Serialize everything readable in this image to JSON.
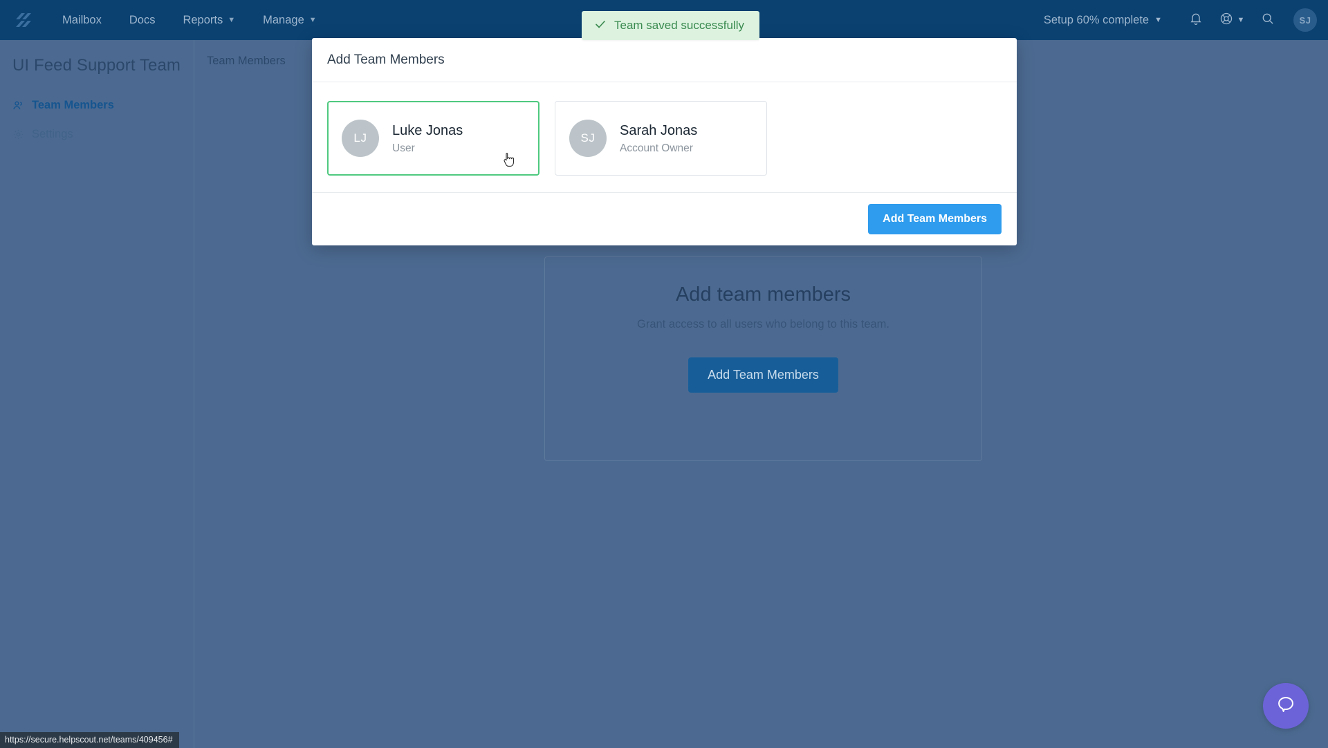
{
  "navbar": {
    "logo_name": "helpscout-logo",
    "links": [
      {
        "label": "Mailbox",
        "has_chevron": false
      },
      {
        "label": "Docs",
        "has_chevron": false
      },
      {
        "label": "Reports",
        "has_chevron": true
      },
      {
        "label": "Manage",
        "has_chevron": true
      }
    ],
    "setup_label": "Setup 60% complete",
    "setup_chevron": "⌄",
    "icons": [
      "bell-icon",
      "lifebuoy-icon",
      "search-icon"
    ],
    "avatar_initials": "SJ"
  },
  "toast": {
    "message": "Team saved successfully",
    "icon": "check-icon",
    "bg_color": "#ddf3e0",
    "text_color": "#3a8a4f"
  },
  "sidebar": {
    "team_title": "UI Feed Support Team",
    "items": [
      {
        "label": "Team Members",
        "icon": "users-icon",
        "active": true
      },
      {
        "label": "Settings",
        "icon": "gear-icon",
        "active": false
      }
    ]
  },
  "tabs": [
    {
      "label": "Team Members",
      "active": true
    }
  ],
  "empty_state": {
    "title": "Add team members",
    "subtitle": "Grant access to all users who belong to this team.",
    "button_label": "Add Team Members"
  },
  "modal": {
    "title": "Add Team Members",
    "members": [
      {
        "initials": "LJ",
        "name": "Luke Jonas",
        "role": "User",
        "selected": true
      },
      {
        "initials": "SJ",
        "name": "Sarah Jonas",
        "role": "Account Owner",
        "selected": false
      }
    ],
    "submit_label": "Add Team Members",
    "selected_border_color": "#4ec97f",
    "submit_color": "#2f9ced"
  },
  "status_bar": {
    "url": "https://secure.helpscout.net/teams/409456#"
  },
  "beacon": {
    "icon": "chat-bubble-icon",
    "color": "#6c63d8"
  }
}
